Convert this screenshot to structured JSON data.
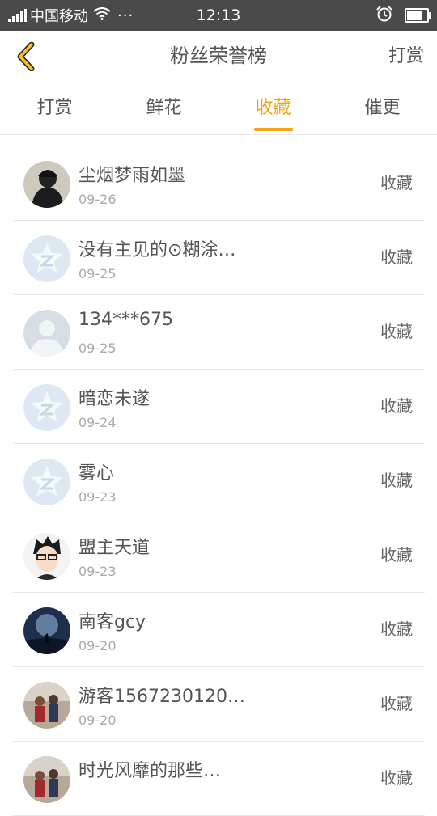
{
  "statusbar": {
    "carrier": "中国移动",
    "time": "12:13",
    "dots": "···",
    "battery_level": 0.85
  },
  "header": {
    "title": "粉丝荣誉榜",
    "action": "打赏"
  },
  "tabs": [
    {
      "label": "打赏",
      "active": false
    },
    {
      "label": "鲜花",
      "active": false
    },
    {
      "label": "收藏",
      "active": true
    },
    {
      "label": "催更",
      "active": false
    }
  ],
  "list": [
    {
      "name": "尘烟梦雨如墨",
      "date": "09-26",
      "action": "收藏",
      "avatar": "photo-dark"
    },
    {
      "name": "没有主见的⊙糊涂…",
      "date": "09-25",
      "action": "收藏",
      "avatar": "default-star"
    },
    {
      "name": "134***675",
      "date": "09-25",
      "action": "收藏",
      "avatar": "default-person"
    },
    {
      "name": "暗恋未遂",
      "date": "09-24",
      "action": "收藏",
      "avatar": "default-star"
    },
    {
      "name": "雾心",
      "date": "09-23",
      "action": "收藏",
      "avatar": "default-star"
    },
    {
      "name": "盟主天道",
      "date": "09-23",
      "action": "收藏",
      "avatar": "anime"
    },
    {
      "name": "南客gcy",
      "date": "09-20",
      "action": "收藏",
      "avatar": "night"
    },
    {
      "name": "游客1567230120…",
      "date": "09-20",
      "action": "收藏",
      "avatar": "people"
    },
    {
      "name": "时光风靡的那些…",
      "date": "",
      "action": "收藏",
      "avatar": "people"
    }
  ],
  "colors": {
    "accent": "#f5a315",
    "statusbar": "#4a4a4a"
  }
}
